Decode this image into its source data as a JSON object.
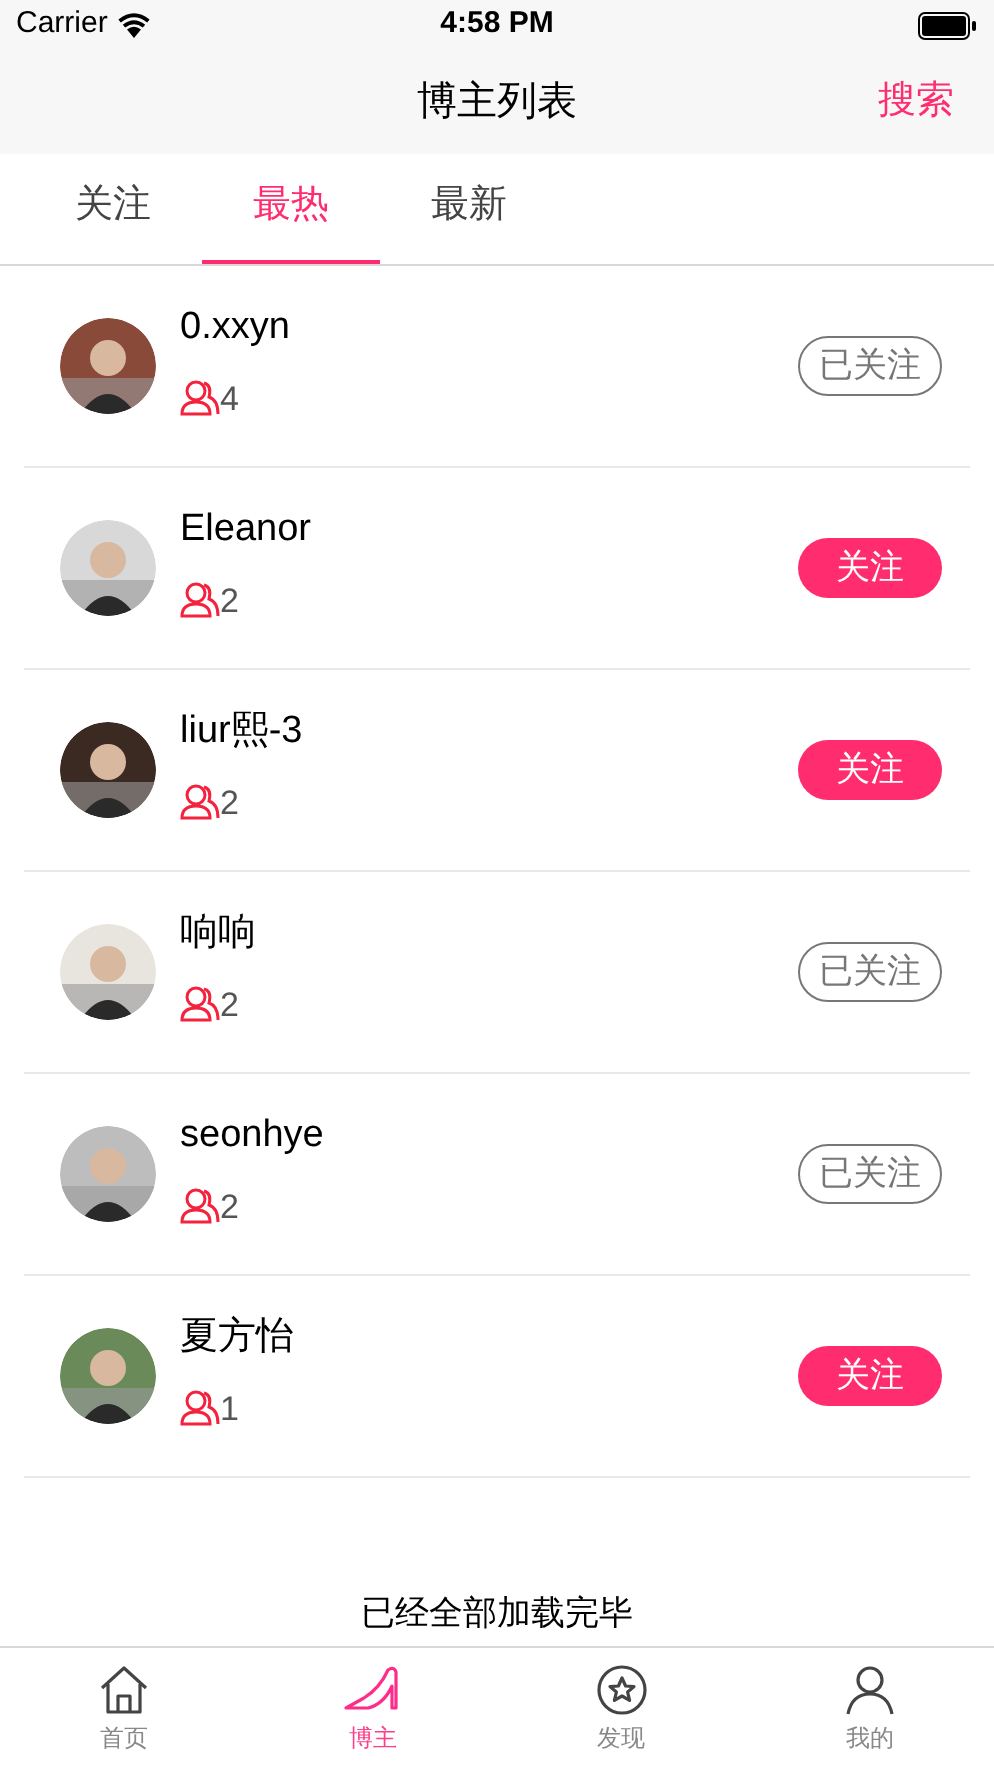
{
  "status_bar": {
    "carrier": "Carrier",
    "time": "4:58 PM"
  },
  "nav": {
    "title": "博主列表",
    "action": "搜索"
  },
  "tabs": [
    {
      "label": "关注",
      "selected": false
    },
    {
      "label": "最热",
      "selected": true
    },
    {
      "label": "最新",
      "selected": false
    }
  ],
  "bloggers": [
    {
      "name": "0.xxyn",
      "fans": "4",
      "button": "已关注",
      "followed": true
    },
    {
      "name": "Eleanor",
      "fans": "2",
      "button": "关注",
      "followed": false
    },
    {
      "name": "liur熙-3",
      "fans": "2",
      "button": "关注",
      "followed": false
    },
    {
      "name": "响响",
      "fans": "2",
      "button": "已关注",
      "followed": true
    },
    {
      "name": "seonhye",
      "fans": "2",
      "button": "已关注",
      "followed": true
    },
    {
      "name": "夏方怡",
      "fans": "1",
      "button": "关注",
      "followed": false
    }
  ],
  "footer_text": "已经全部加载完毕",
  "tab_bar": [
    {
      "label": "首页",
      "kind": "home",
      "selected": false
    },
    {
      "label": "博主",
      "kind": "shoe",
      "selected": true
    },
    {
      "label": "发现",
      "kind": "star",
      "selected": false
    },
    {
      "label": "我的",
      "kind": "person",
      "selected": false
    }
  ]
}
